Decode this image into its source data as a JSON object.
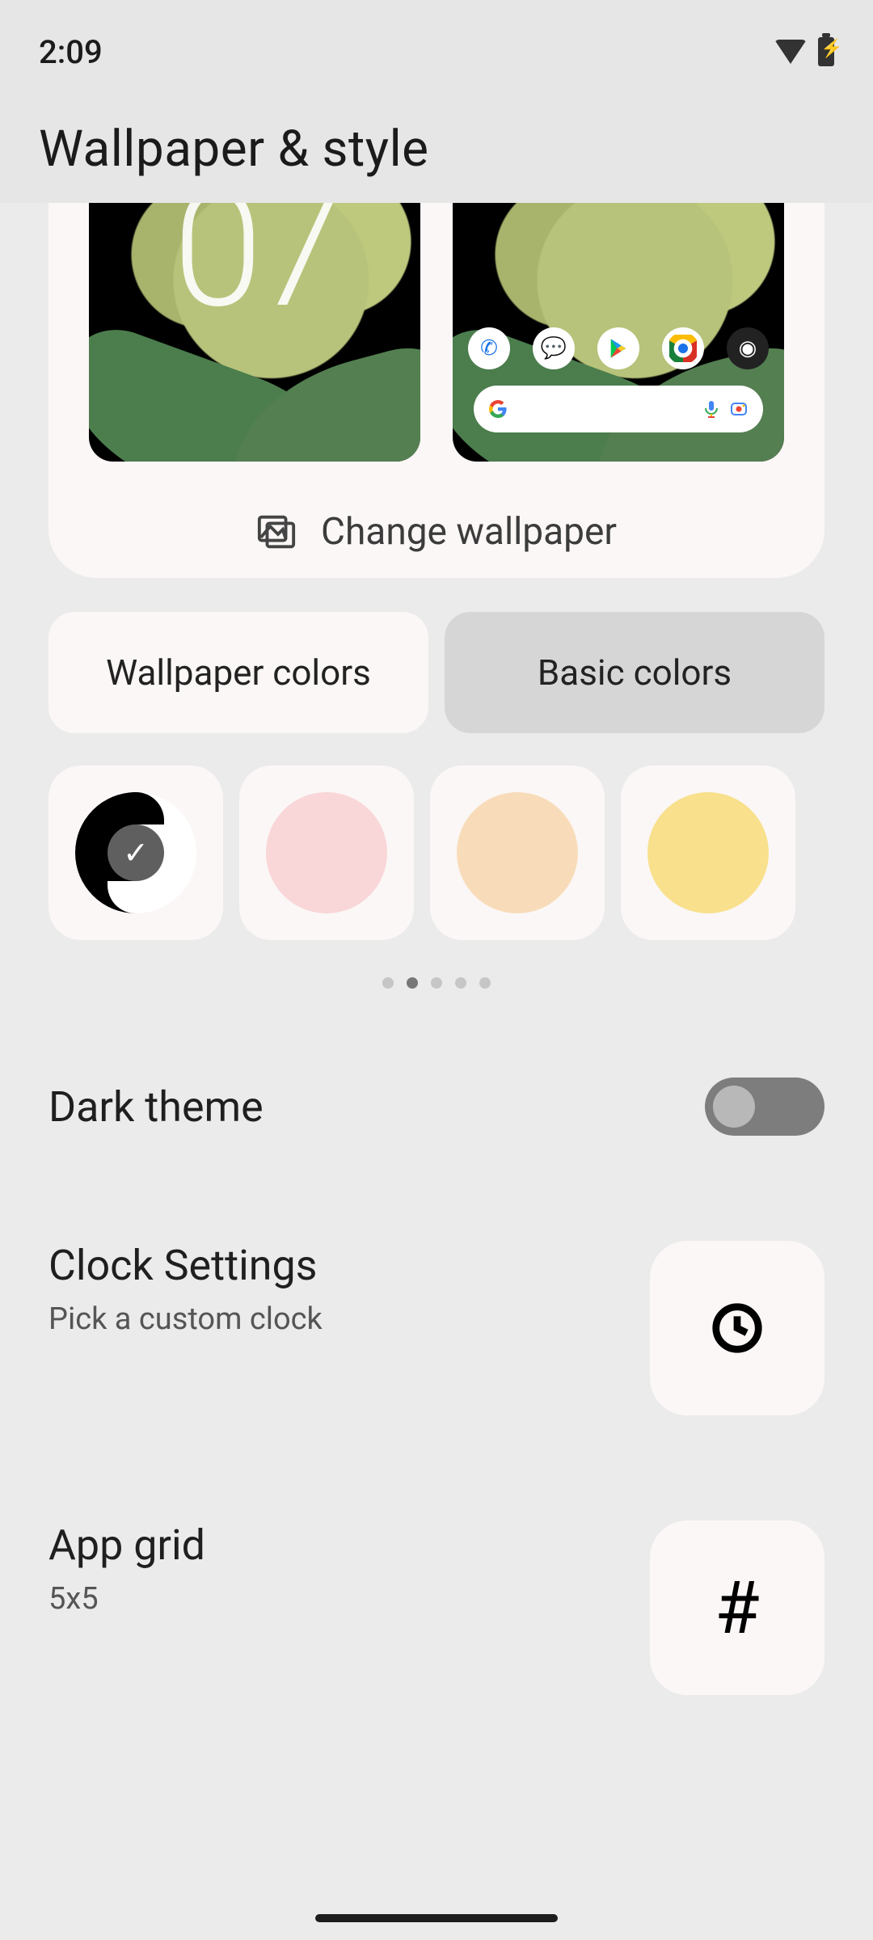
{
  "statusbar": {
    "time": "2:09"
  },
  "page_title": "Wallpaper & style",
  "change_wallpaper_label": "Change wallpaper",
  "tabs": {
    "wallpaper_colors": "Wallpaper colors",
    "basic_colors": "Basic colors",
    "selected_index": 1
  },
  "swatches": [
    {
      "type": "dynamic",
      "selected": true
    },
    {
      "type": "solid",
      "color": "#f9d6d8"
    },
    {
      "type": "solid",
      "color": "#f8dcba"
    },
    {
      "type": "solid",
      "color": "#f8e08c"
    }
  ],
  "pagination": {
    "count": 5,
    "active_index": 1
  },
  "dark_theme": {
    "label": "Dark theme",
    "enabled": false
  },
  "clock_settings": {
    "title": "Clock Settings",
    "subtitle": "Pick a custom clock"
  },
  "app_grid": {
    "title": "App grid",
    "subtitle": "5x5"
  }
}
